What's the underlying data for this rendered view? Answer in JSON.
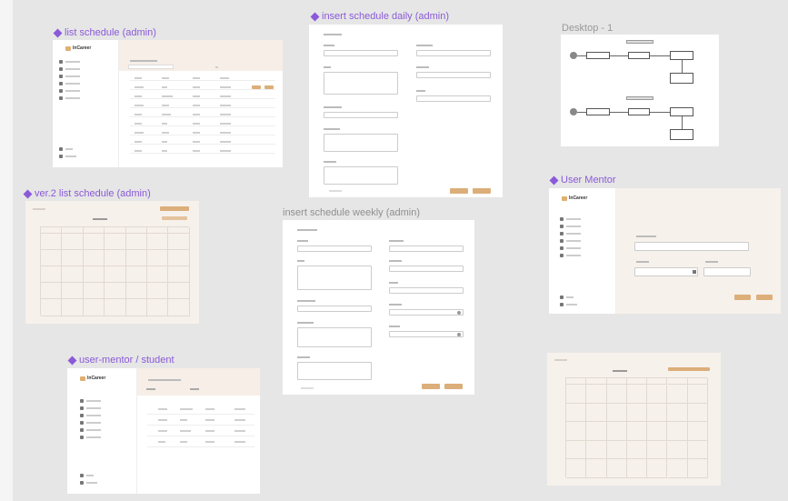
{
  "frames": {
    "list_schedule": {
      "label": "list schedule (admin)"
    },
    "insert_daily": {
      "label": "insert schedule daily (admin)"
    },
    "desktop": {
      "label": "Desktop - 1"
    },
    "ver2_list": {
      "label": "ver.2 list schedule (admin)"
    },
    "insert_weekly": {
      "label": "insert schedule weekly (admin)"
    },
    "user_mentor": {
      "label": "User Mentor"
    },
    "user_mentor_student": {
      "label": "user-mentor / student"
    }
  },
  "brand": {
    "logo_text": "InCareer"
  },
  "colors": {
    "accent": "#8a5ad8",
    "button": "#dcae7a",
    "frame_beige": "#f7f1ec",
    "canvas": "#e6e6e6"
  },
  "icons": {
    "frame_marker": "diamond-icon"
  }
}
